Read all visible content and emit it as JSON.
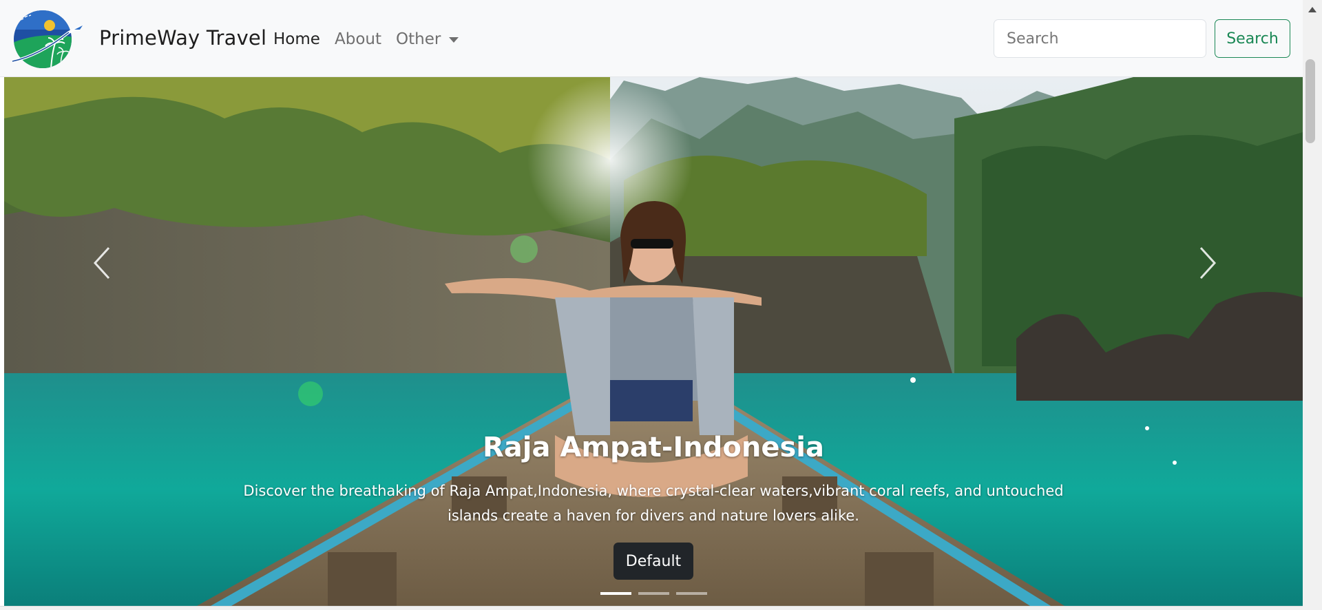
{
  "brand": {
    "name": "PrimeWay Travel"
  },
  "nav": {
    "home": "Home",
    "about": "About",
    "other": "Other"
  },
  "search": {
    "placeholder": "Search",
    "button_label": "Search"
  },
  "carousel": {
    "slide_title": "Raja Ampat-Indonesia",
    "slide_text": "Discover the breathaking of Raja Ampat,Indonesia, where crystal-clear waters,vibrant coral reefs, and untouched islands create a haven for divers and nature lovers alike.",
    "button_label": "Default",
    "indicators": 3,
    "active_index": 0
  },
  "colors": {
    "navbar_bg": "#f8f9fa",
    "search_accent": "#198754",
    "button_dark": "#212529"
  }
}
